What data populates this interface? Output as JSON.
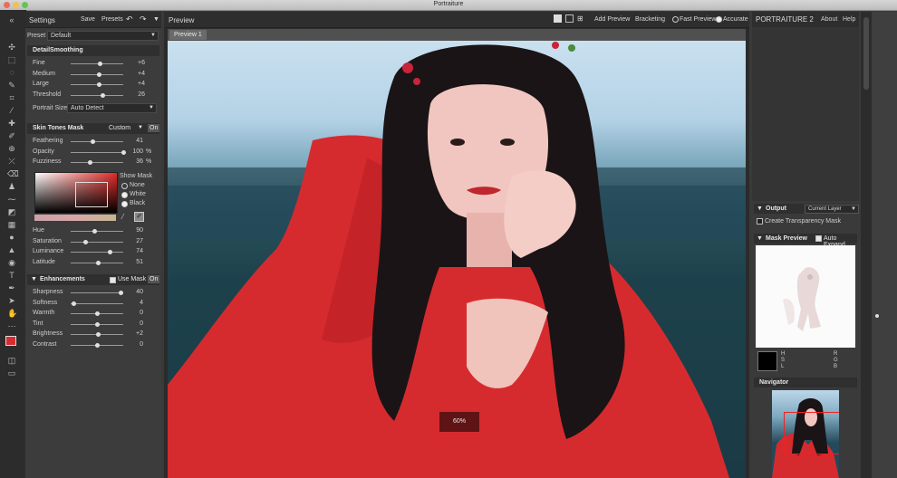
{
  "window": {
    "title": "Portraiture"
  },
  "settings": {
    "title": "Settings",
    "save_label": "Save",
    "presets_label": "Presets",
    "preset_label": "Preset",
    "preset_value": "Default",
    "detail": {
      "title": "DetailSmoothing",
      "sliders": [
        {
          "label": "Fine",
          "value": "+6",
          "pos": 0.55
        },
        {
          "label": "Medium",
          "value": "+4",
          "pos": 0.53
        },
        {
          "label": "Large",
          "value": "+4",
          "pos": 0.53
        },
        {
          "label": "Threshold",
          "value": "26",
          "pos": 0.6
        }
      ],
      "portrait_size_label": "Portrait Size",
      "portrait_size_value": "Auto Detect"
    },
    "skin": {
      "title": "Skin Tones Mask",
      "mode": "Custom",
      "on_label": "On",
      "sliders": [
        {
          "label": "Feathering",
          "value": "41",
          "pct": "",
          "pos": 0.41
        },
        {
          "label": "Opacity",
          "value": "100",
          "pct": "%",
          "pos": 1.0
        },
        {
          "label": "Fuzziness",
          "value": "36",
          "pct": "%",
          "pos": 0.36
        }
      ],
      "show_mask_label": "Show Mask",
      "show_mask_options": [
        "None",
        "White",
        "Black"
      ],
      "show_mask_selected": 0,
      "hsl": [
        {
          "label": "Hue",
          "value": "90",
          "pos": 0.45
        },
        {
          "label": "Saturation",
          "value": "27",
          "pos": 0.27
        },
        {
          "label": "Luminance",
          "value": "74",
          "pos": 0.74
        },
        {
          "label": "Latitude",
          "value": "51",
          "pos": 0.51
        }
      ]
    },
    "enh": {
      "title": "Enhancements",
      "use_mask_label": "Use Mask",
      "on_label": "On",
      "sliders": [
        {
          "label": "Sharpness",
          "value": "40",
          "pos": 0.95
        },
        {
          "label": "Softness",
          "value": "4",
          "pos": 0.05
        },
        {
          "label": "Warmth",
          "value": "0",
          "pos": 0.5
        },
        {
          "label": "Tint",
          "value": "0",
          "pos": 0.5
        },
        {
          "label": "Brightness",
          "value": "+2",
          "pos": 0.52
        },
        {
          "label": "Contrast",
          "value": "0",
          "pos": 0.5
        }
      ]
    }
  },
  "preview": {
    "title": "Preview",
    "add_preview_label": "Add Preview",
    "bracketing_label": "Bracketing",
    "fast_preview_label": "Fast Preview",
    "accurate_label": "Accurate",
    "tab_label": "Preview 1",
    "zoom": "60%"
  },
  "right": {
    "app_name": "PORTRAITURE 2",
    "about_label": "About",
    "help_label": "Help",
    "output_title": "Output",
    "output_value": "Current Layer",
    "transparency_label": "Create Transparency Mask",
    "mask_preview_title": "Mask Preview",
    "auto_expand_label": "Auto Expand",
    "hsl_letters": [
      "H",
      "S",
      "L"
    ],
    "rgb_letters": [
      "R",
      "G",
      "B"
    ],
    "navigator_title": "Navigator"
  },
  "colors": {
    "accent_red": "#d92b32",
    "panel": "#3c3c3c",
    "header": "#2f2f2f"
  }
}
